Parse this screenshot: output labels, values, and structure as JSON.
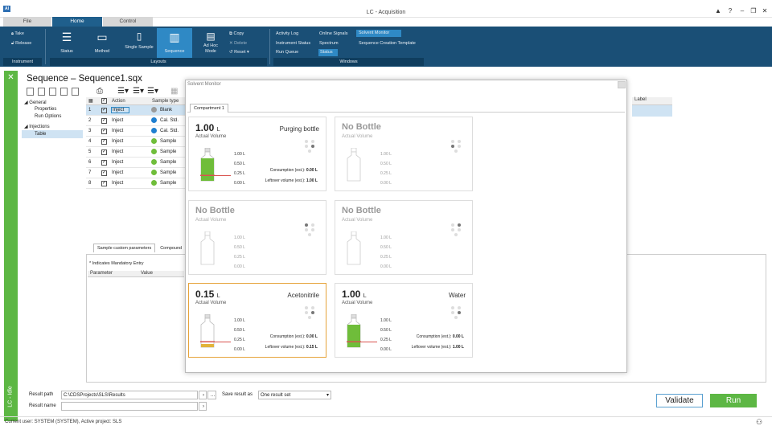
{
  "window": {
    "title": "LC - Acquisition",
    "logo": "AI",
    "controls": [
      "▲",
      "?",
      "–",
      "❐",
      "✕"
    ]
  },
  "ribbon": {
    "tabs": [
      "File",
      "Home",
      "Control"
    ],
    "instrument": {
      "take": "Take",
      "release": "Release",
      "group": "Instrument"
    },
    "layouts": {
      "status": "Status",
      "method": "Method",
      "single_sample": "Single Sample",
      "sequence": "Sequence",
      "ad_hoc": "Ad Hoc Mode",
      "group": "Layouts"
    },
    "edit": {
      "copy": "Copy",
      "delete": "Delete",
      "reset": "Reset"
    },
    "windows": {
      "activity_log": "Activity Log",
      "online_signals": "Online Signals",
      "solvent_monitor": "Solvent Monitor",
      "instrument_status": "Instrument Status",
      "spectrum": "Spectrum",
      "sequence_template": "Sequence Creation Template",
      "run_queue": "Run Queue",
      "status": "Status",
      "group": "Windows"
    }
  },
  "rail": {
    "label": "LC - Idle"
  },
  "document": {
    "title": "Sequence – Sequence1.sqx"
  },
  "nav": {
    "general": "General",
    "properties": "Properties",
    "run_options": "Run Options",
    "injections": "Injections",
    "table": "Table"
  },
  "grid": {
    "headers": {
      "action": "Action",
      "sample_type": "Sample type",
      "label": "Label"
    },
    "rows": [
      {
        "n": "1",
        "action": "Inject",
        "type": "Blank",
        "color": "#9a9a9a"
      },
      {
        "n": "2",
        "action": "Inject",
        "type": "Cal. Std.",
        "color": "#1f7fd0"
      },
      {
        "n": "3",
        "action": "Inject",
        "type": "Cal. Std.",
        "color": "#1f7fd0"
      },
      {
        "n": "4",
        "action": "Inject",
        "type": "Sample",
        "color": "#6fbd3a"
      },
      {
        "n": "5",
        "action": "Inject",
        "type": "Sample",
        "color": "#6fbd3a"
      },
      {
        "n": "6",
        "action": "Inject",
        "type": "Sample",
        "color": "#6fbd3a"
      },
      {
        "n": "7",
        "action": "Inject",
        "type": "Sample",
        "color": "#6fbd3a"
      },
      {
        "n": "8",
        "action": "Inject",
        "type": "Sample",
        "color": "#6fbd3a"
      }
    ]
  },
  "lower": {
    "tab_params": "Sample custom parameters",
    "tab_compounds": "Compound",
    "mandatory": "* Indicates Mandatory Entry",
    "col_parameter": "Parameter",
    "col_value": "Value"
  },
  "bottom": {
    "result_path_label": "Result path",
    "result_path_value": "C:\\CDSProjects\\SLS\\Results",
    "save_as_label": "Save result as",
    "save_as_value": "One result set",
    "result_name_label": "Result name",
    "validate": "Validate",
    "run": "Run"
  },
  "status_bar": {
    "text": "Current user: SYSTEM (SYSTEM), Active project: SLS"
  },
  "solvent_monitor": {
    "title": "Solvent Monitor",
    "tab": "Compartment 1",
    "scale": [
      "1.00 L",
      "0.50 L",
      "0.25 L",
      "0.00 L"
    ],
    "consumption_label": "Consumption (est.):",
    "leftover_label": "Leftover volume (est.):",
    "bottles": [
      {
        "volume": "1.00",
        "unit": "L",
        "actual": "Actual Volume",
        "name": "Purging bottle",
        "fill": 1.0,
        "color": "#6fbd3a",
        "consumption": "0.00 L",
        "leftover": "1.00 L",
        "active_dot": 3
      },
      {
        "volume": "No Bottle",
        "unit": "",
        "actual": "Actual Volume",
        "name": "",
        "fill": 0,
        "color": "",
        "consumption": "",
        "leftover": "",
        "active_dot": 2
      },
      {
        "volume": "No Bottle",
        "unit": "",
        "actual": "Actual Volume",
        "name": "",
        "fill": 0,
        "color": "",
        "consumption": "",
        "leftover": "",
        "active_dot": 0
      },
      {
        "volume": "No Bottle",
        "unit": "",
        "actual": "Actual Volume",
        "name": "",
        "fill": 0,
        "color": "",
        "consumption": "",
        "leftover": "",
        "active_dot": 1
      },
      {
        "volume": "0.15",
        "unit": "L",
        "actual": "Actual Volume",
        "name": "Acetonitrile",
        "fill": 0.15,
        "color": "#e2b33a",
        "consumption": "0.00 L",
        "leftover": "0.15 L",
        "active_dot": 3
      },
      {
        "volume": "1.00",
        "unit": "L",
        "actual": "Actual Volume",
        "name": "Water",
        "fill": 1.0,
        "color": "#6fbd3a",
        "consumption": "0.00 L",
        "leftover": "1.00 L",
        "active_dot": 3
      }
    ]
  },
  "colors": {
    "accent": "#1a4f76",
    "selected_tab": "#2f89c5",
    "green": "#5db744",
    "highlight": "#e6a33a"
  }
}
